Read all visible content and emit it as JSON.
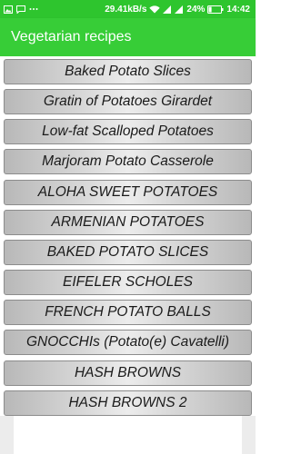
{
  "status_bar": {
    "left_icons": [
      "image-icon",
      "sms-icon",
      "more-dots-icon"
    ],
    "speed": "29.41kB/s",
    "battery_percent": "24%",
    "time": "14:42",
    "battery_level": 0.24
  },
  "app_bar": {
    "title": "Vegetarian recipes"
  },
  "recipes": [
    "Baked Potato Slices",
    "Gratin of Potatoes Girardet",
    "Low-fat Scalloped Potatoes",
    "Marjoram Potato Casserole",
    "ALOHA SWEET POTATOES",
    "ARMENIAN POTATOES",
    "BAKED POTATO SLICES",
    "EIFELER SCHOLES",
    "FRENCH POTATO BALLS",
    "GNOCCHIs (Potato(e) Cavatelli)",
    "HASH BROWNS",
    "HASH BROWNS 2"
  ],
  "colors": {
    "status_bar": "#2ec52e",
    "app_bar": "#37cd37"
  }
}
